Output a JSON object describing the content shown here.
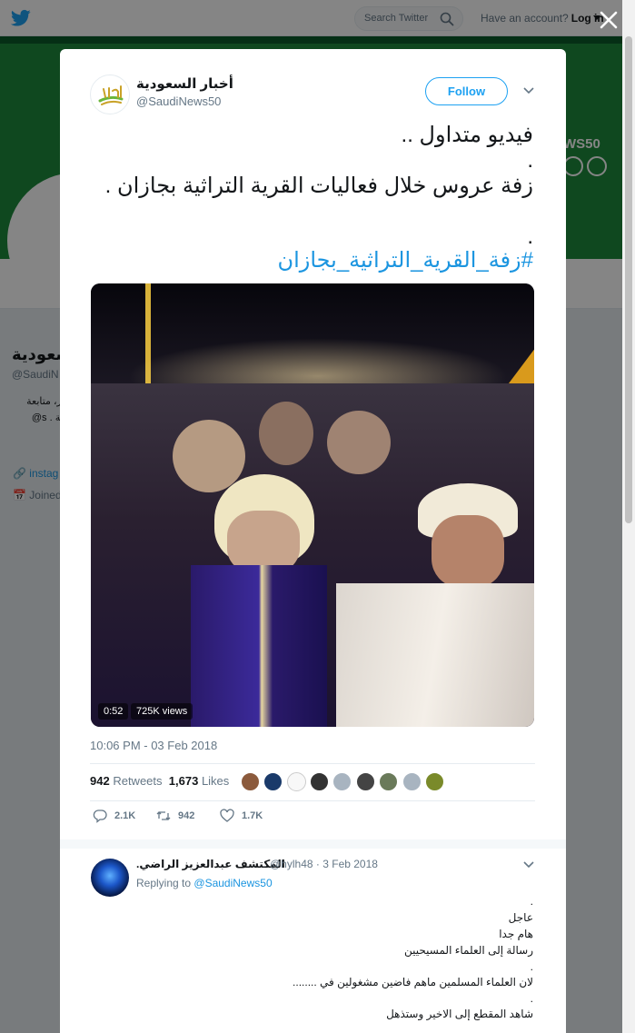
{
  "topbar": {
    "logo": "twitter-bird-icon",
    "search_placeholder": "Search Twitter",
    "account_prompt": "Have an account?",
    "login_label": "Log in"
  },
  "background_profile": {
    "name": "السعودية",
    "handle": "@SaudiN",
    "bio": "يتر، متابعة رية . s@",
    "link": "instag",
    "joined": "Joined",
    "banner_text": "WS50"
  },
  "tweet": {
    "account_name": "أخبار السعودية",
    "account_handle": "@SaudiNews50",
    "follow_label": "Follow",
    "text_lines": [
      "فيديو متداول ..",
      ".",
      "زفة عروس خلال فعاليات القرية التراثية بجازان .",
      "",
      "."
    ],
    "hashtag": "#زفة_القرية_التراثية_بجازان",
    "video": {
      "duration": "0:52",
      "views": "725K views"
    },
    "timestamp": "10:06 PM - 03 Feb 2018",
    "retweets_count": "942",
    "retweets_label": "Retweets",
    "likes_count": "1,673",
    "likes_label": "Likes",
    "likers_count": 9,
    "actions": {
      "replies": "2.1K",
      "retweets": "942",
      "likes": "1.7K"
    }
  },
  "reply": {
    "name": "المكتشف عبدالعزيز الراضي.",
    "handle": "@hylh48",
    "separator": "·",
    "date": "3 Feb 2018",
    "replying_to_label": "Replying to",
    "replying_to_handle": "@SaudiNews50",
    "lines": [
      ".",
      "عاجل",
      "هام جدا",
      "رسالة إلى العلماء المسيحيين",
      ".",
      "لان العلماء المسلمين ماهم فاضين مشغولين في ........",
      ".",
      "شاهد المقطع إلى الاخير وستذهل"
    ]
  },
  "colors": {
    "twitter_blue": "#1da1f2",
    "link_blue": "#1b95e0",
    "banner_green": "#1d8a3c"
  }
}
